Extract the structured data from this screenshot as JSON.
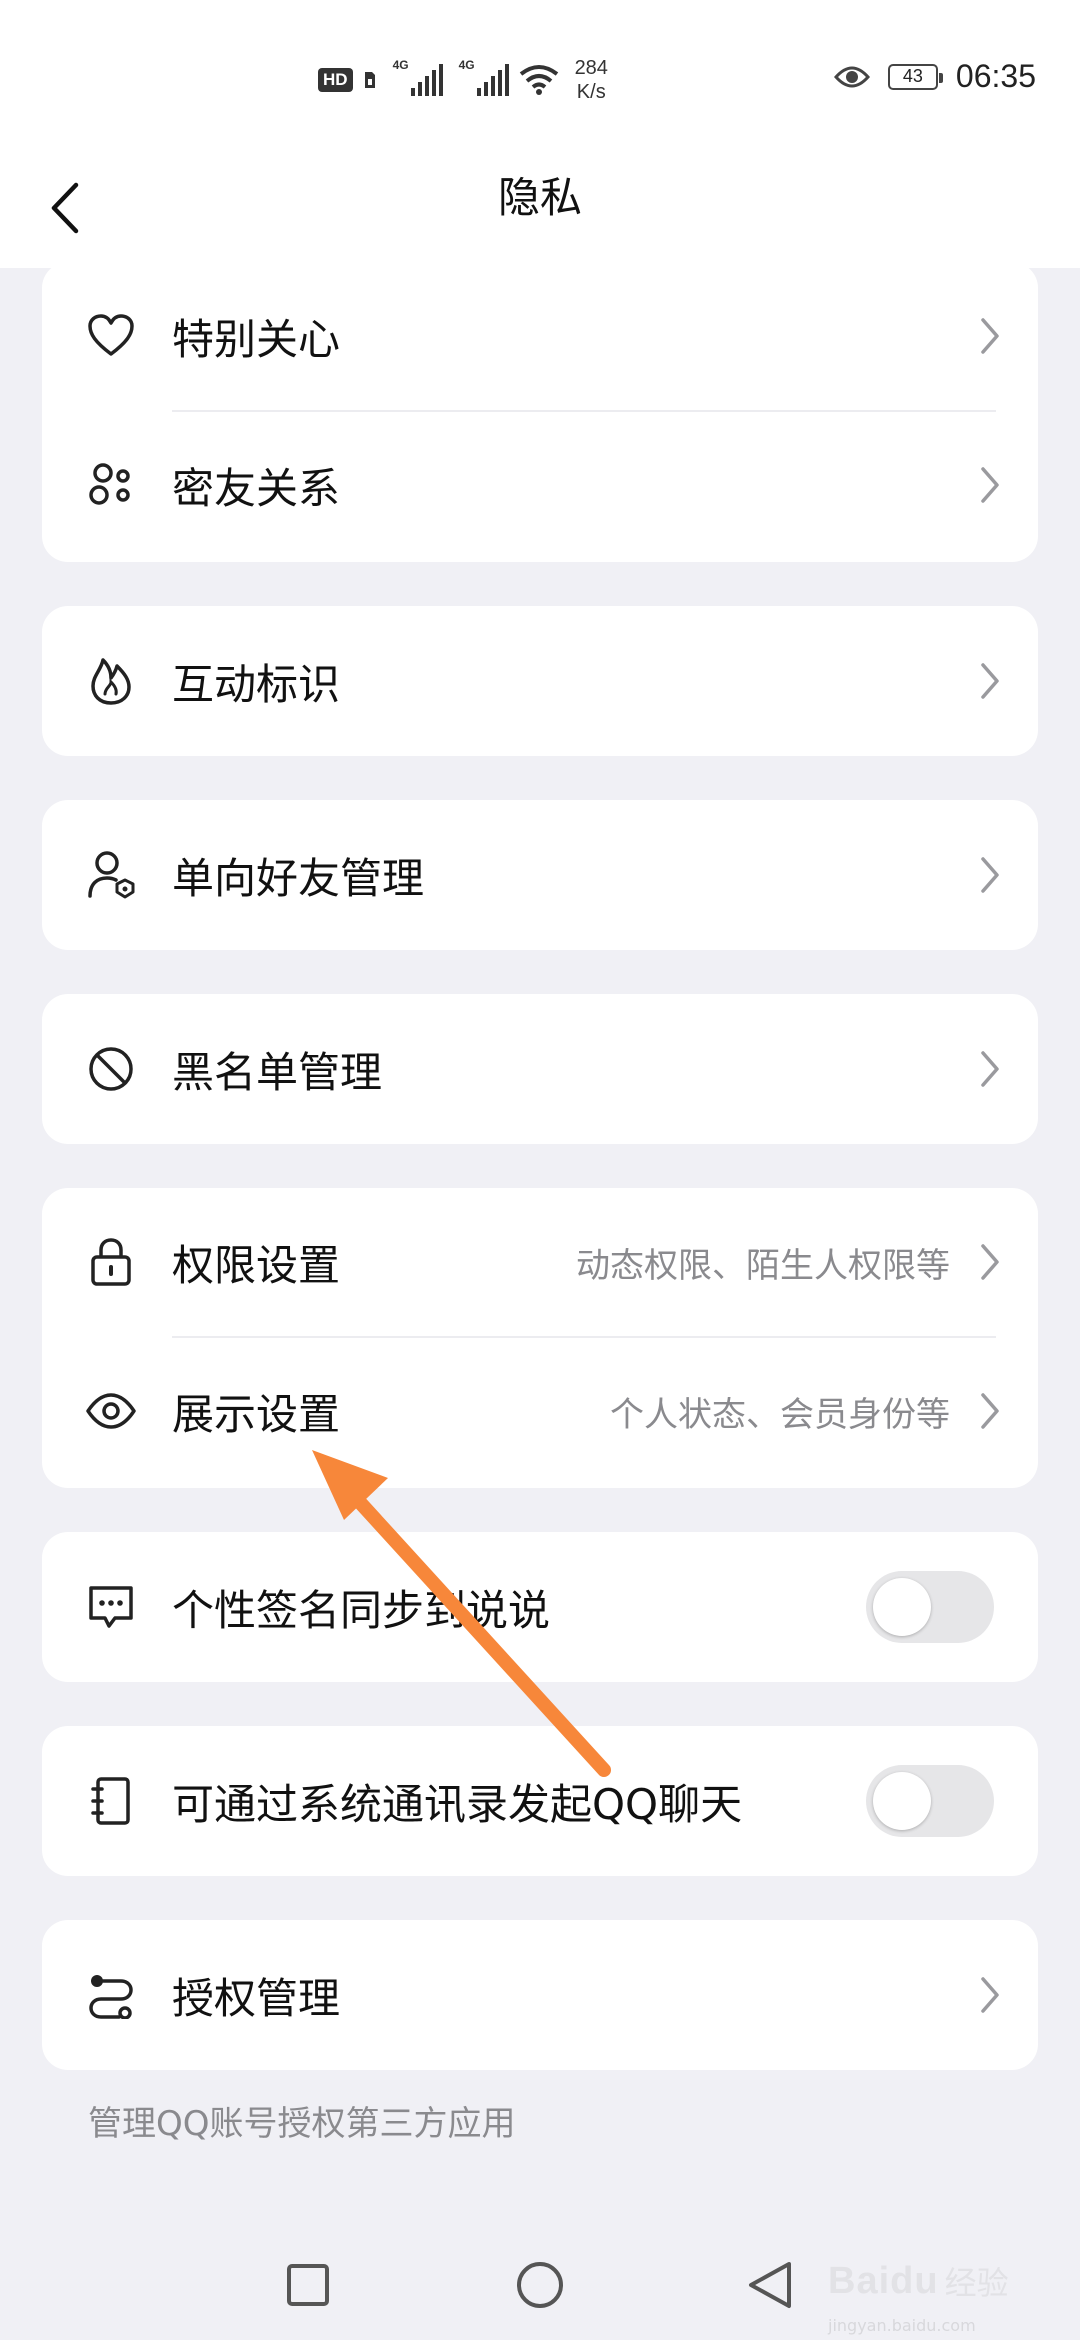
{
  "status_bar": {
    "hd_badge": "HD",
    "signal_tag_1": "4G",
    "signal_tag_2": "4G",
    "speed_value": "284",
    "speed_unit": "K/s",
    "battery": "43",
    "time": "06:35"
  },
  "header": {
    "title": "隐私"
  },
  "groups": [
    {
      "items": [
        {
          "label": "特别关心",
          "icon": "heart-icon",
          "kind": "chevron"
        },
        {
          "label": "密友关系",
          "icon": "close-friends-icon",
          "kind": "chevron"
        }
      ]
    },
    {
      "items": [
        {
          "label": "互动标识",
          "icon": "flame-icon",
          "kind": "chevron"
        }
      ]
    },
    {
      "items": [
        {
          "label": "单向好友管理",
          "icon": "user-shield-icon",
          "kind": "chevron"
        }
      ]
    },
    {
      "items": [
        {
          "label": "黑名单管理",
          "icon": "block-icon",
          "kind": "chevron"
        }
      ]
    },
    {
      "items": [
        {
          "label": "权限设置",
          "sub": "动态权限、陌生人权限等",
          "icon": "lock-icon",
          "kind": "chevron"
        },
        {
          "label": "展示设置",
          "sub": "个人状态、会员身份等",
          "icon": "eye-icon",
          "kind": "chevron"
        }
      ]
    },
    {
      "items": [
        {
          "label": "个性签名同步到说说",
          "icon": "message-icon",
          "kind": "toggle",
          "toggle_on": false
        }
      ]
    },
    {
      "items": [
        {
          "label": "可通过系统通讯录发起QQ聊天",
          "icon": "contacts-book-icon",
          "kind": "toggle",
          "toggle_on": false
        }
      ]
    },
    {
      "items": [
        {
          "label": "授权管理",
          "icon": "authorization-icon",
          "kind": "chevron"
        }
      ]
    }
  ],
  "footnote": "管理QQ账号授权第三方应用",
  "colors": {
    "background": "#f0f0f5",
    "card": "#ffffff",
    "annotation_arrow": "#f7873a",
    "secondary_text": "#8a8a8e"
  },
  "watermark": {
    "brand": "Baidu",
    "cn": "经验",
    "domain": "jingyan.baidu.com"
  }
}
